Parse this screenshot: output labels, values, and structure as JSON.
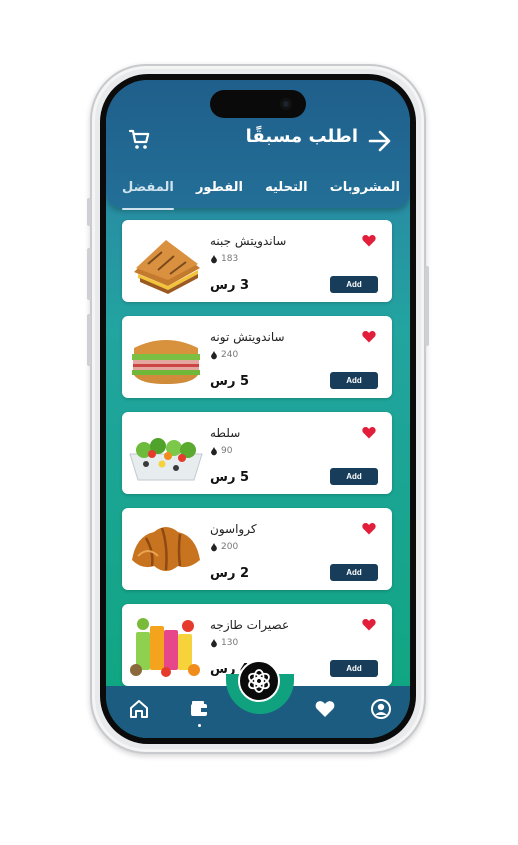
{
  "header": {
    "title": "اطلب مسبقًا",
    "tabs": [
      {
        "label": "المشروبات",
        "active": false
      },
      {
        "label": "التحليه",
        "active": false
      },
      {
        "label": "الفطور",
        "active": false
      },
      {
        "label": "المفضل",
        "active": true
      }
    ]
  },
  "items": [
    {
      "name": "ساندويتش جبنه",
      "calories": "183",
      "price": "3 رس",
      "add_label": "Add",
      "image": "cheese-sandwich"
    },
    {
      "name": "ساندويتش تونه",
      "calories": "240",
      "price": "5 رس",
      "add_label": "Add",
      "image": "tuna-sandwich"
    },
    {
      "name": "سلطه",
      "calories": "90",
      "price": "5 رس",
      "add_label": "Add",
      "image": "salad"
    },
    {
      "name": "كرواسون",
      "calories": "200",
      "price": "2 رس",
      "add_label": "Add",
      "image": "croissant"
    },
    {
      "name": "عصيرات طازجه",
      "calories": "130",
      "price": "4 رس",
      "add_label": "Add",
      "image": "fresh-juices"
    }
  ],
  "colors": {
    "header": "#1f5f8b",
    "accent": "#173d5a",
    "heart": "#e21f3a",
    "gradient_bottom": "#0ea67e"
  },
  "nav": {
    "icons": [
      "home-icon",
      "wallet-icon",
      "chatgpt-icon",
      "heart-icon",
      "profile-icon"
    ]
  }
}
